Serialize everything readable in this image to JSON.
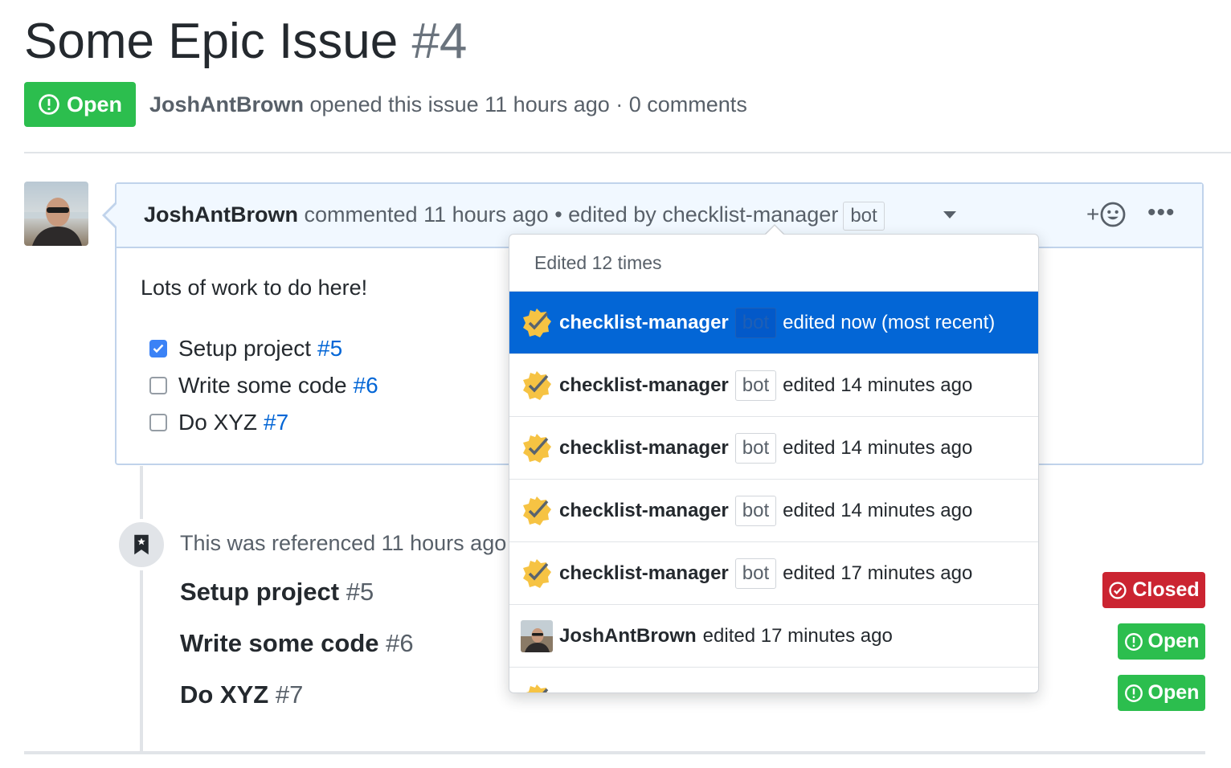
{
  "issue": {
    "title": "Some Epic Issue",
    "number": "#4",
    "state": "Open",
    "author": "JoshAntBrown",
    "opened_text": " opened this issue 11 hours ago · 0 comments"
  },
  "comment": {
    "author": "JoshAntBrown",
    "meta": " commented 11 hours ago • edited by checklist-manager",
    "bot_label": "bot",
    "reaction_plus": "+",
    "more": "•••",
    "body": "Lots of work to do here!",
    "tasks": [
      {
        "label": "Setup project",
        "ref": "#5",
        "checked": true
      },
      {
        "label": "Write some code",
        "ref": "#6",
        "checked": false
      },
      {
        "label": "Do XYZ",
        "ref": "#7",
        "checked": false
      }
    ]
  },
  "references": {
    "text": "This was referenced 11 hours ago",
    "items": [
      {
        "title": "Setup project",
        "num": "#5",
        "state": "Closed"
      },
      {
        "title": "Write some code",
        "num": "#6",
        "state": "Open"
      },
      {
        "title": "Do XYZ",
        "num": "#7",
        "state": "Open"
      }
    ]
  },
  "edit_history": {
    "header": "Edited 12 times",
    "rows": [
      {
        "user": "checklist-manager",
        "bot": "bot",
        "edited": "edited now (most recent)",
        "active": true
      },
      {
        "user": "checklist-manager",
        "bot": "bot",
        "edited": "edited 14 minutes ago"
      },
      {
        "user": "checklist-manager",
        "bot": "bot",
        "edited": "edited 14 minutes ago"
      },
      {
        "user": "checklist-manager",
        "bot": "bot",
        "edited": "edited 14 minutes ago"
      },
      {
        "user": "checklist-manager",
        "bot": "bot",
        "edited": "edited 17 minutes ago"
      },
      {
        "user": "JoshAntBrown",
        "edited": "edited 17 minutes ago"
      }
    ]
  },
  "colors": {
    "open_green": "#2cbe4e",
    "closed_red": "#cb2431",
    "link_blue": "#0366d6",
    "active_blue": "#0366d6"
  },
  "icons": {
    "state": "issue-opened-icon",
    "closed": "issue-closed-icon",
    "bot_avatar": "checklist-badge-icon",
    "reference": "bookmark-icon",
    "reaction": "smiley-icon",
    "dropdown": "triangle-down-icon"
  }
}
